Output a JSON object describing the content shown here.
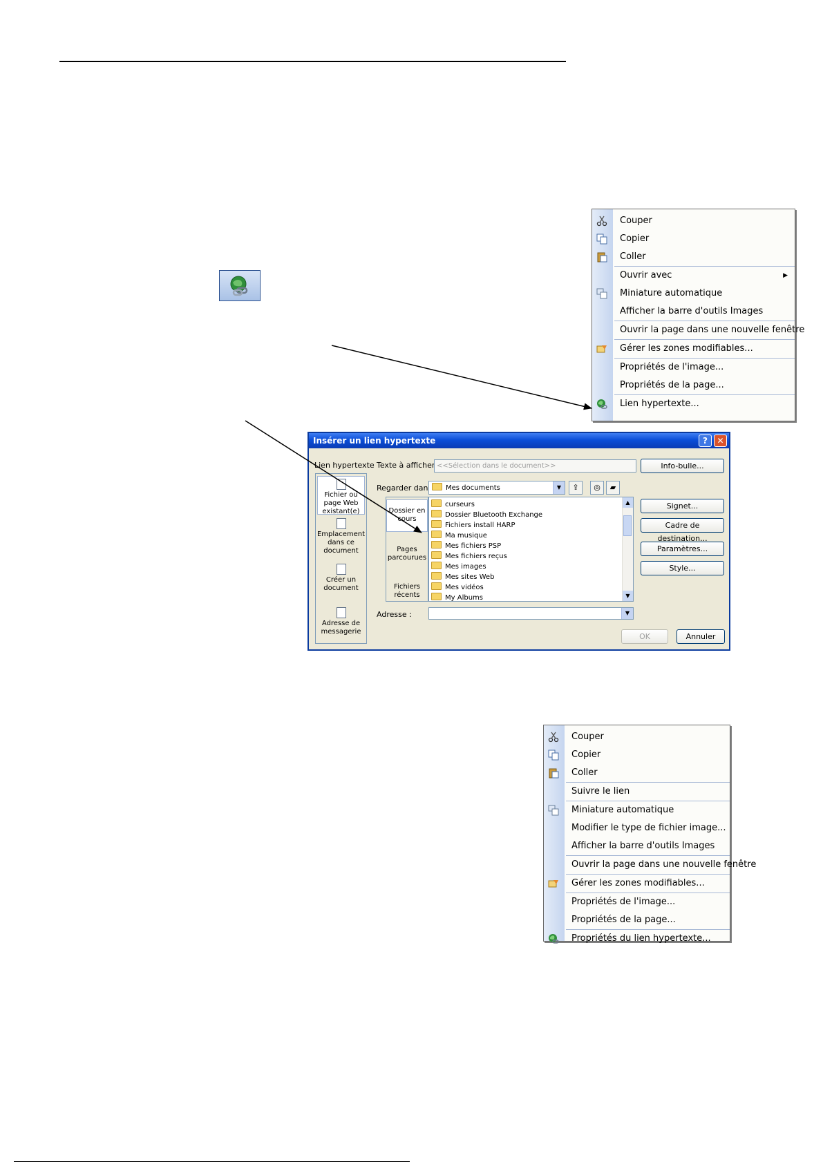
{
  "page": {},
  "hyperlink_toolbar_button": {
    "icon": "hyperlink-globe-icon"
  },
  "context_menu_1": {
    "items": [
      {
        "label": "Couper",
        "icon": "scissors-icon",
        "separator_before": false,
        "submenu": false
      },
      {
        "label": "Copier",
        "icon": "copy-icon",
        "separator_before": false,
        "submenu": false
      },
      {
        "label": "Coller",
        "icon": "paste-icon",
        "separator_before": false,
        "submenu": false
      },
      {
        "label": "Ouvrir avec",
        "icon": "",
        "separator_before": true,
        "submenu": true
      },
      {
        "label": "Miniature automatique",
        "icon": "thumbnail-icon",
        "separator_before": false,
        "submenu": false
      },
      {
        "label": "Afficher la barre d'outils Images",
        "icon": "",
        "separator_before": false,
        "submenu": false
      },
      {
        "label": "Ouvrir la page dans une nouvelle fenêtre",
        "icon": "",
        "separator_before": true,
        "submenu": false
      },
      {
        "label": "Gérer les zones modifiables...",
        "icon": "editable-regions-icon",
        "separator_before": true,
        "submenu": false
      },
      {
        "label": "Propriétés de l'image...",
        "icon": "",
        "separator_before": true,
        "submenu": false
      },
      {
        "label": "Propriétés de la page...",
        "icon": "",
        "separator_before": false,
        "submenu": false
      },
      {
        "label": "Lien hypertexte...",
        "icon": "hyperlink-globe-icon",
        "separator_before": true,
        "submenu": false
      }
    ]
  },
  "context_menu_2": {
    "items": [
      {
        "label": "Couper",
        "icon": "scissors-icon",
        "separator_before": false
      },
      {
        "label": "Copier",
        "icon": "copy-icon",
        "separator_before": false
      },
      {
        "label": "Coller",
        "icon": "paste-icon",
        "separator_before": false
      },
      {
        "label": "Suivre le lien",
        "icon": "",
        "separator_before": true
      },
      {
        "label": "Miniature automatique",
        "icon": "thumbnail-icon",
        "separator_before": true
      },
      {
        "label": "Modifier le type de fichier image...",
        "icon": "",
        "separator_before": false
      },
      {
        "label": "Afficher la barre d'outils Images",
        "icon": "",
        "separator_before": false
      },
      {
        "label": "Ouvrir la page dans une nouvelle fenêtre",
        "icon": "",
        "separator_before": true
      },
      {
        "label": "Gérer les zones modifiables...",
        "icon": "editable-regions-icon",
        "separator_before": true
      },
      {
        "label": "Propriétés de l'image...",
        "icon": "",
        "separator_before": true
      },
      {
        "label": "Propriétés de la page...",
        "icon": "",
        "separator_before": false
      },
      {
        "label": "Propriétés du lien hypertexte...",
        "icon": "hyperlink-globe-icon",
        "separator_before": true
      }
    ]
  },
  "dialog": {
    "title": "Insérer un lien hypertexte",
    "help_label": "?",
    "close_label": "✕",
    "link_to_label": "Lien hypertexte",
    "text_to_display_label": "Texte à afficher :",
    "text_to_display_value": "<<Sélection dans le document>>",
    "screen_tip_button": "Info-bulle...",
    "look_in_label": "Regarder dans :",
    "look_in_value": "Mes documents",
    "places": [
      {
        "label": "Fichier ou page Web existant(e)",
        "selected": true
      },
      {
        "label": "Emplacement dans ce document",
        "selected": false
      },
      {
        "label": "Créer un document",
        "selected": false
      },
      {
        "label": "Adresse de messagerie",
        "selected": false
      }
    ],
    "sub_places": [
      {
        "label": "Dossier en cours",
        "selected": true
      },
      {
        "label": "Pages parcourues",
        "selected": false
      },
      {
        "label": "Fichiers récents",
        "selected": false
      }
    ],
    "files": [
      "curseurs",
      "Dossier Bluetooth Exchange",
      "Fichiers install HARP",
      "Ma musique",
      "Mes fichiers PSP",
      "Mes fichiers reçus",
      "Mes images",
      "Mes sites Web",
      "Mes vidéos",
      "My Albums"
    ],
    "side_buttons": [
      "Signet...",
      "Cadre de destination...",
      "Paramètres...",
      "Style..."
    ],
    "address_label": "Adresse :",
    "address_value": "",
    "ok_label": "OK",
    "cancel_label": "Annuler"
  }
}
